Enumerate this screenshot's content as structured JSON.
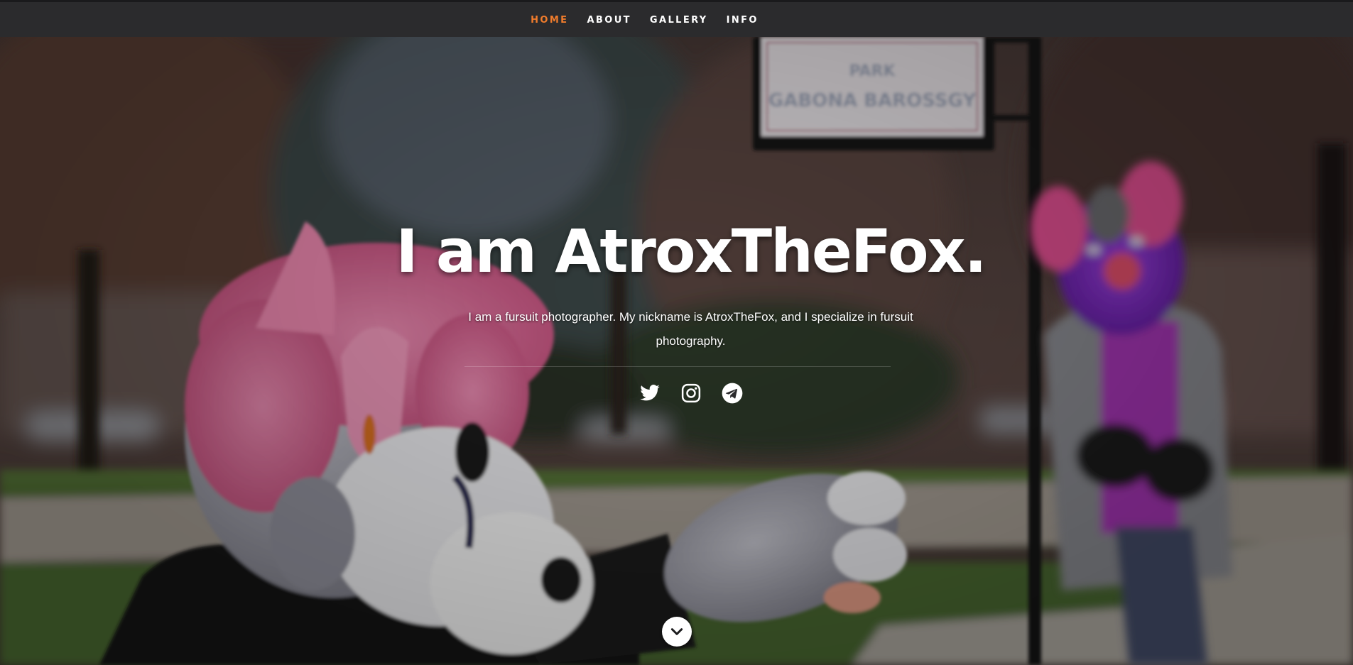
{
  "nav": {
    "items": [
      {
        "label": "Home",
        "current": true
      },
      {
        "label": "About",
        "current": false
      },
      {
        "label": "Gallery",
        "current": false
      },
      {
        "label": "Info",
        "current": false
      }
    ],
    "accent_color": "#f07c2c"
  },
  "hero": {
    "title": "I am AtroxTheFox.",
    "description": "I am a fursuit photographer. My nickname is AtroxTheFox, and I specialize in fursuit photography.",
    "background_image": "photo of two fursuiters in a park: a grey-and-pink fox reaching out in the foreground, a purple fursuiter in a grey coat standing by a street sign in the background",
    "sign_text": "PARK GABONA BAROSSGY"
  },
  "social": [
    {
      "name": "twitter",
      "icon": "twitter-icon"
    },
    {
      "name": "instagram",
      "icon": "instagram-icon"
    },
    {
      "name": "telegram",
      "icon": "telegram-icon"
    }
  ],
  "scroll_button": {
    "icon": "chevron-down-icon"
  }
}
